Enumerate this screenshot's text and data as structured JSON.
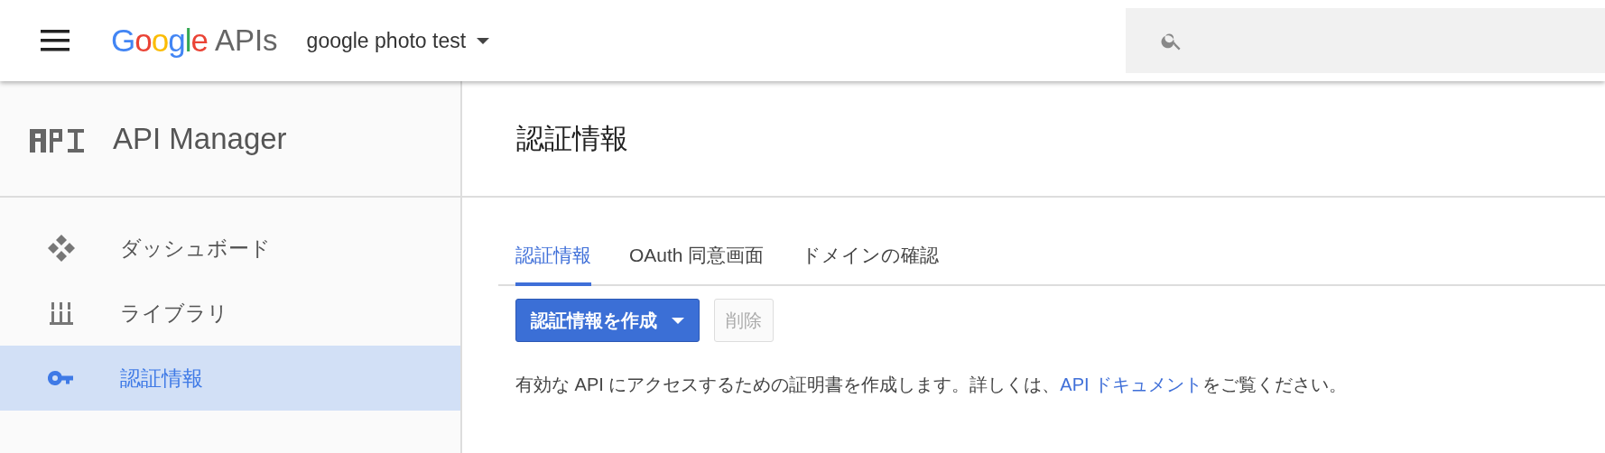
{
  "header": {
    "logo": "Google",
    "logo_suffix": "APIs",
    "project": "google photo test"
  },
  "sidebar": {
    "title": "API Manager",
    "items": [
      {
        "label": "ダッシュボード",
        "kind": "dashboard",
        "selected": false
      },
      {
        "label": "ライブラリ",
        "kind": "library",
        "selected": false
      },
      {
        "label": "認証情報",
        "kind": "key",
        "selected": true
      }
    ]
  },
  "page": {
    "title": "認証情報",
    "tabs": [
      {
        "label": "認証情報",
        "selected": true
      },
      {
        "label": "OAuth 同意画面",
        "selected": false
      },
      {
        "label": "ドメインの確認",
        "selected": false
      }
    ],
    "create_button": "認証情報を作成",
    "delete_button": {
      "label": "削除",
      "disabled": true
    },
    "description": {
      "before": "有効な API にアクセスするための証明書を作成します。詳しくは、",
      "link": "API ドキュメント",
      "after": "をご覧ください。"
    }
  }
}
